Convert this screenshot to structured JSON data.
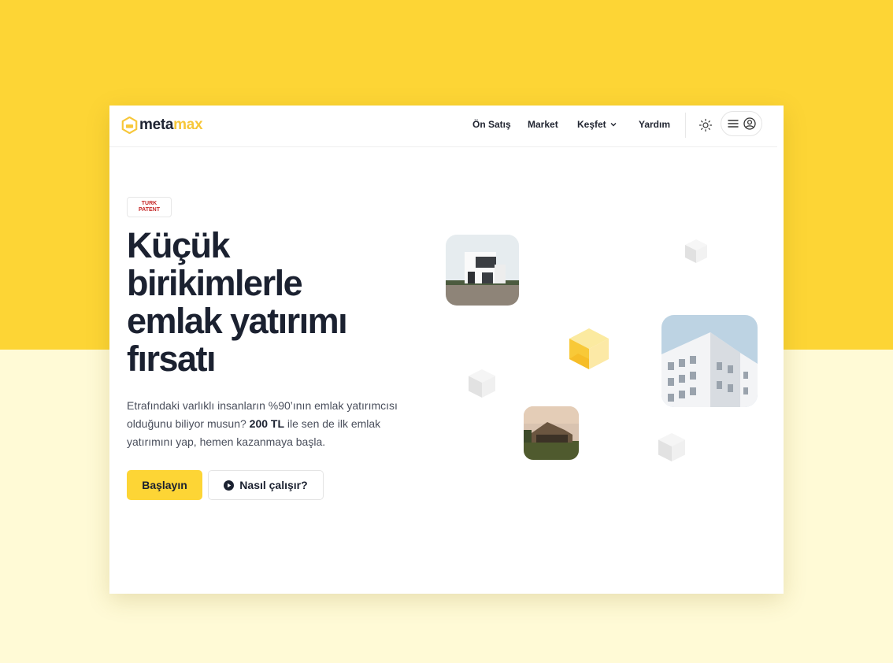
{
  "brand": {
    "name_part1": "meta",
    "name_part2": "max",
    "accent": "#FDD535",
    "logo_accent": "#F7C73A"
  },
  "nav": {
    "items": [
      {
        "label": "Ön Satış"
      },
      {
        "label": "Market"
      },
      {
        "label": "Keşfet"
      },
      {
        "label": "Yardım"
      }
    ],
    "theme_icon": "sun-icon",
    "menu_icon": "hamburger-icon",
    "user_icon": "user-circle-icon"
  },
  "hero": {
    "badge_line1": "TURK",
    "badge_line2": "PATENT",
    "title_lines": [
      "Küçük",
      "birikimlerle",
      "emlak yatırımı",
      "fırsatı"
    ],
    "description_before": "Etrafındaki varlıklı insanların %90’ının emlak yatırımcısı olduğunu biliyor musun? ",
    "description_bold": "200 TL",
    "description_after": " ile sen de ilk emlak yatırımını yap, hemen kazanmaya başla.",
    "primary_cta": "Başlayın",
    "secondary_cta": "Nasıl çalışır?",
    "play_icon": "play-circle-icon"
  },
  "colors": {
    "background_top": "#FDD535",
    "background_bottom": "#FFFAD6",
    "text_dark": "#1B2130",
    "text_muted": "#4A4F5C"
  }
}
